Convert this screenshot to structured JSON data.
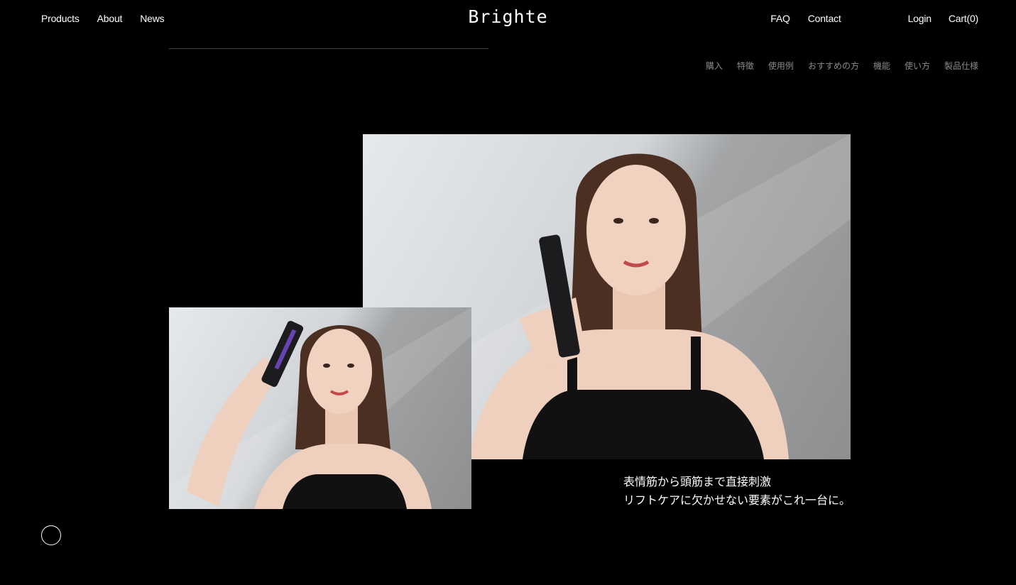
{
  "header": {
    "logo": "Brighte",
    "nav_left": [
      "Products",
      "About",
      "News"
    ],
    "nav_right": {
      "faq": "FAQ",
      "contact": "Contact",
      "login": "Login",
      "cart": "Cart(0)"
    }
  },
  "subnav": [
    "購入",
    "特徴",
    "使用例",
    "おすすめの方",
    "機能",
    "使い方",
    "製品仕様"
  ],
  "caption": {
    "line1": "表情筋から頭筋まで直接刺激",
    "line2": "リフトケアに欠かせない要素がこれ一台に。"
  },
  "images": {
    "large": "woman holding brush device to cheek",
    "small": "woman using brush device on scalp"
  },
  "colors": {
    "background": "#000000",
    "text": "#ffffff",
    "subnav_text": "#8a8a8a"
  }
}
